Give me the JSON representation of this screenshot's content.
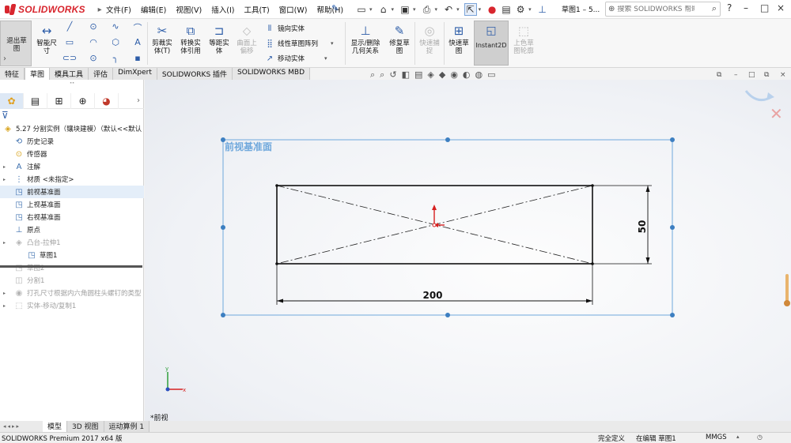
{
  "app": {
    "brand": "SOLIDWORKS"
  },
  "menu": [
    "文件(F)",
    "编辑(E)",
    "视图(V)",
    "插入(I)",
    "工具(T)",
    "窗口(W)",
    "帮助(H)"
  ],
  "quick_access": [
    "new-icon",
    "open-icon",
    "save-icon",
    "print-icon",
    "undo-icon",
    "select-icon",
    "rebuild-icon",
    "file-properties-icon",
    "options-icon",
    "pin-icon"
  ],
  "document_title": "草图1 – 5...",
  "search": {
    "placeholder": "搜索 SOLIDWORKS 帮助"
  },
  "window_buttons": [
    "?",
    "–",
    "□",
    "×"
  ],
  "commands": {
    "exit_sketch": "退出草\n图",
    "smart_dim": "智能尺\n寸",
    "trim": "剪裁实\n体(T)",
    "convert": "转换实\n体引用",
    "offset": "等距实\n体",
    "surface_offset": "曲面上\n偏移",
    "mirror": "镜向实体",
    "linear_pattern": "线性草图阵列",
    "move": "移动实体",
    "display_delete": "显示/删除\n几何关系",
    "repair": "修复草\n图",
    "quick_snap": "快速捕\n捉",
    "rapid_sketch": "快速草\n图",
    "instant2d": "Instant2D",
    "shaded_contours": "上色草\n图轮廓"
  },
  "tabs": [
    "特征",
    "草图",
    "模具工具",
    "评估",
    "DimXpert",
    "SOLIDWORKS 插件",
    "SOLIDWORKS MBD"
  ],
  "active_tab": "草图",
  "feature_tree": {
    "tabs": [
      "feature-manager-icon",
      "property-manager-icon",
      "configuration-manager-icon",
      "dimxpert-icon",
      "display-manager-icon"
    ],
    "root": "5.27 分割实例（镶块建模）（默认<<默认",
    "items": [
      {
        "label": "历史记录",
        "icon": "history-icon",
        "state": "normal"
      },
      {
        "label": "传感器",
        "icon": "sensor-icon",
        "state": "normal"
      },
      {
        "label": "注解",
        "icon": "annotation-icon",
        "state": "normal"
      },
      {
        "label": "材质 <未指定>",
        "icon": "material-icon",
        "state": "normal"
      },
      {
        "label": "前视基准面",
        "icon": "plane-icon",
        "state": "selected"
      },
      {
        "label": "上视基准面",
        "icon": "plane-icon",
        "state": "normal"
      },
      {
        "label": "右视基准面",
        "icon": "plane-icon",
        "state": "normal"
      },
      {
        "label": "原点",
        "icon": "origin-icon",
        "state": "normal"
      },
      {
        "label": "凸台-拉伸1",
        "icon": "extrude-icon",
        "state": "dim"
      },
      {
        "label": "草图1",
        "icon": "sketch-icon",
        "state": "normal"
      },
      {
        "label": "草图2",
        "icon": "sketch-icon",
        "state": "dim"
      },
      {
        "label": "分割1",
        "icon": "split-icon",
        "state": "dim"
      },
      {
        "label": "打孔尺寸根据内六角圆柱头螺钉的类型",
        "icon": "hole-icon",
        "state": "dim"
      },
      {
        "label": "实体-移动/复制1",
        "icon": "move-copy-icon",
        "state": "dim"
      }
    ]
  },
  "graphics": {
    "plane_label": "前视基准面",
    "dimensions": {
      "width": "200",
      "height": "50"
    },
    "view_name": "*前视",
    "triad": {
      "x": "x",
      "y": "y"
    }
  },
  "bottom_tabs": [
    "模型",
    "3D 视图",
    "运动算例 1"
  ],
  "status": {
    "edition": "SOLIDWORKS Premium 2017 x64 版",
    "definition": "完全定义",
    "editing": "在编辑 草图1",
    "units": "MMGS"
  },
  "colors": {
    "accent": "#2d5da8",
    "brand": "#d8262e",
    "plane": "#6fa8dc",
    "sketch": "#111111"
  }
}
